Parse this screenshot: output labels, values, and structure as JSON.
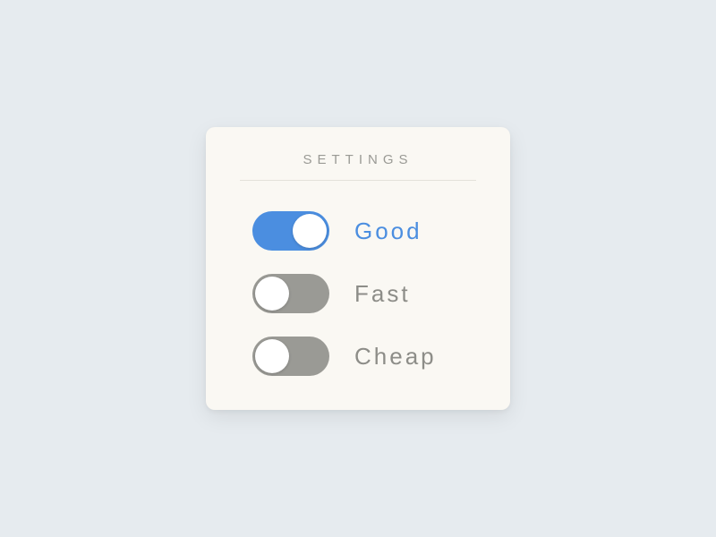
{
  "card": {
    "title": "SETTINGS"
  },
  "toggles": [
    {
      "label": "Good",
      "enabled": true
    },
    {
      "label": "Fast",
      "enabled": false
    },
    {
      "label": "Cheap",
      "enabled": false
    }
  ],
  "colors": {
    "accent": "#4b8ee0",
    "neutral": "#9a9a95",
    "card_bg": "#faf8f3",
    "page_bg": "#e6ebef"
  }
}
